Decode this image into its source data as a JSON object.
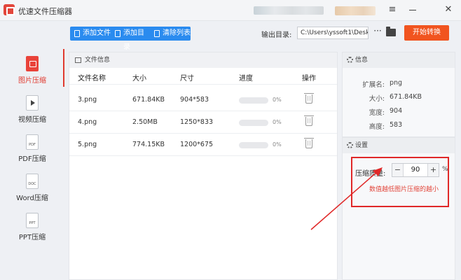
{
  "app": {
    "title": "优速文件压缩器"
  },
  "window_controls": {
    "menu": "≡",
    "close": "✕"
  },
  "toolbar": {
    "add_file": "添加文件",
    "add_dir": "添加目录",
    "clear_list": "清除列表",
    "output_label": "输出目录:",
    "output_path": "C:\\Users\\yssoft1\\Deskt",
    "more": "···",
    "start": "开始转换"
  },
  "sidebar": {
    "items": [
      {
        "label": "图片压缩",
        "active": true,
        "icon": "image-doc-icon"
      },
      {
        "label": "视频压缩",
        "active": false,
        "icon": "video-doc-icon"
      },
      {
        "label": "PDF压缩",
        "active": false,
        "tag": "PDF",
        "icon": "pdf-doc-icon"
      },
      {
        "label": "Word压缩",
        "active": false,
        "tag": "DOC",
        "icon": "word-doc-icon"
      },
      {
        "label": "PPT压缩",
        "active": false,
        "tag": "PPT",
        "icon": "ppt-doc-icon"
      }
    ]
  },
  "file_panel": {
    "title": "文件信息",
    "columns": [
      "文件名称",
      "大小",
      "尺寸",
      "进度",
      "操作"
    ],
    "rows": [
      {
        "name": "3.png",
        "size": "671.84KB",
        "dims": "904*583",
        "progress": 0,
        "progress_text": "0%"
      },
      {
        "name": "4.png",
        "size": "2.50MB",
        "dims": "1250*833",
        "progress": 0,
        "progress_text": "0%"
      },
      {
        "name": "5.png",
        "size": "774.15KB",
        "dims": "1200*675",
        "progress": 0,
        "progress_text": "0%"
      }
    ]
  },
  "info_panel": {
    "title": "信息",
    "fields": [
      {
        "key": "扩展名:",
        "value": "png"
      },
      {
        "key": "大小:",
        "value": "671.84KB"
      },
      {
        "key": "宽度:",
        "value": "904"
      },
      {
        "key": "高度:",
        "value": "583"
      }
    ]
  },
  "settings_panel": {
    "title": "设置",
    "quality_label": "压缩质量:",
    "quality_value": "90",
    "minus": "−",
    "plus": "+",
    "unit": "%",
    "hint": "数值越低图片压缩的越小"
  },
  "colors": {
    "accent_blue": "#2a8bef",
    "start_orange": "#f1541f",
    "active_red": "#e03a2f",
    "annotation_red": "#e02828"
  }
}
